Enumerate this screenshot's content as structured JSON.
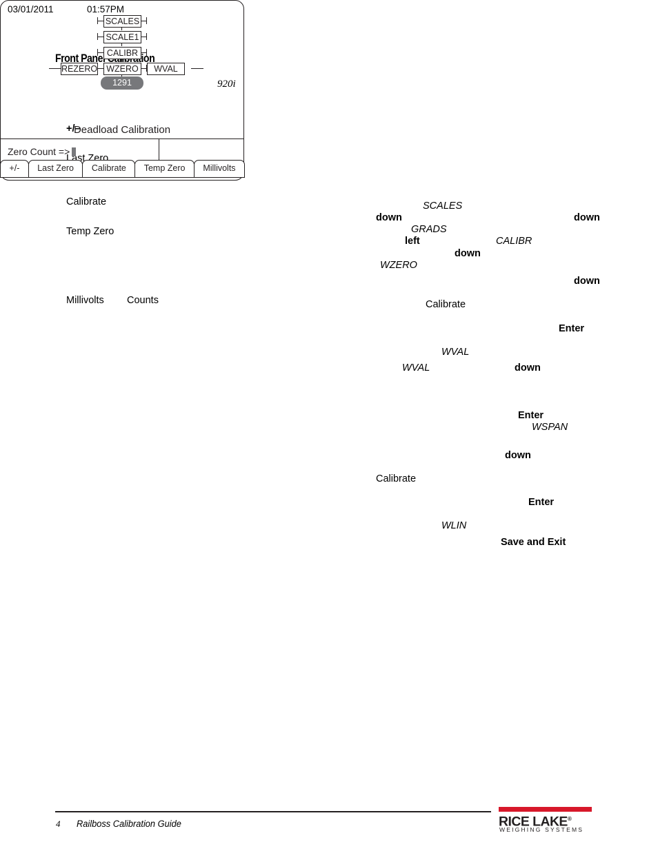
{
  "page": {
    "section_heading": "Front Panel Calibration",
    "model_reference": "920i"
  },
  "left_column_terms": {
    "plus_minus": "+/–",
    "last_zero": "Last Zero",
    "calibrate": "Calibrate",
    "temp_zero": "Temp Zero",
    "millivolts": "Millivolts",
    "counts": "Counts"
  },
  "right_column_terms": {
    "scales": "SCALES",
    "down_1": "down",
    "down_2": "down",
    "grads": "GRADS",
    "left": "left",
    "calibr": "CALIBR",
    "down_3": "down",
    "wzero": "WZERO",
    "down_4": "down",
    "calibrate_1": "Calibrate",
    "enter_1": "Enter",
    "wval_1": "WVAL",
    "wval_2": "WVAL",
    "down_5": "down",
    "enter_2": "Enter",
    "wspan": "WSPAN",
    "down_6": "down",
    "calibrate_2": "Calibrate",
    "enter_3": "Enter",
    "wlin": "WLIN",
    "save_and_exit": "Save and Exit"
  },
  "display_panel": {
    "date": "03/01/2011",
    "time": "01:57PM",
    "menu_tree": {
      "level_1": "SCALES",
      "level_2": "SCALE1",
      "level_3": "CALIBR",
      "level_4_left": "REZERO",
      "level_4_center": "WZERO",
      "level_4_right": "WVAL",
      "value": "1291"
    },
    "mode_label": "Deadload Calibration",
    "prompt": "Zero Count =>",
    "softkeys": [
      "+/-",
      "Last Zero",
      "Calibrate",
      "Temp Zero",
      "Millivolts"
    ]
  },
  "footer": {
    "page_number": "4",
    "document_title": "Railboss Calibration Guide",
    "logo": {
      "wordmark": "RICE LAKE",
      "registered": "®",
      "tagline": "WEIGHING SYSTEMS",
      "accent_color": "#d7182a"
    }
  }
}
